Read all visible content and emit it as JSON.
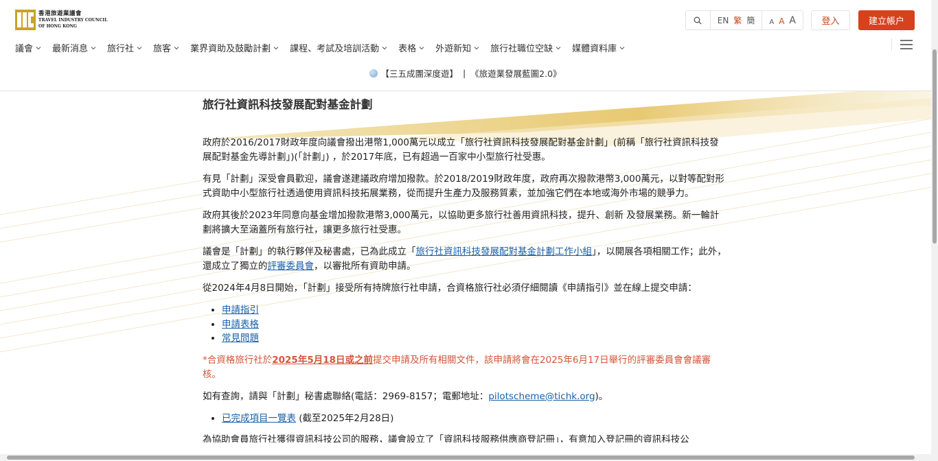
{
  "brand": {
    "logo_zh": "香港旅遊業議會",
    "logo_en_line1": "TRAVEL INDUSTRY COUNCIL",
    "logo_en_line2": "OF HONG KONG",
    "accent_color": "#d7411c"
  },
  "toolbar": {
    "lang_en": "EN",
    "lang_tc": "繁",
    "lang_sc": "簡",
    "size_small": "A",
    "size_medium": "A",
    "size_large": "A",
    "login_label": "登入",
    "register_label": "建立帳户"
  },
  "nav": {
    "items": [
      "議會",
      "最新消息",
      "旅行社",
      "旅客",
      "業界資助及鼓勵計劃",
      "課程、考試及培訓活動",
      "表格",
      "外遊新知",
      "旅行社職位空缺",
      "媒體資料庫"
    ]
  },
  "announcement": {
    "link1": "【三五成團深度遊】",
    "separator": "|",
    "link2": "《旅遊業發展藍圖2.0》"
  },
  "page": {
    "title": "旅行社資訊科技發展配對基金計劃",
    "p1": "政府於2016/2017財政年度向議會撥出港幣1,000萬元以成立「旅行社資訊科技發展配對基金計劃」(前稱「旅行社資訊科技發展配對基金先導計劃」)(「計劃」) ，於2017年底，已有超過一百家中小型旅行社受惠。",
    "p2": "有見「計劃」深受會員歡迎，議會遂建議政府增加撥款。於2018/2019財政年度，政府再次撥款港幣3,000萬元，以對等配對形式資助中小型旅行社透過使用資訊科技拓展業務，從而提升生產力及服務質素，並加強它們在本地或海外市場的競爭力。",
    "p3": "政府其後於2023年同意向基金增加撥款港幣3,000萬元，以協助更多旅行社善用資訊科技，提升、創新 及發展業務。新一輪計劃將擴大至涵蓋所有旅行社，讓更多旅行社受惠。",
    "p4_pre": "議會是「計劃」的執行夥伴及秘書處，已為此成立「",
    "p4_link1": "旅行社資訊科技發展配對基金計劃工作小組",
    "p4_mid": "」，以開展各項相關工作；此外，還成立了獨立的",
    "p4_link2": "評審委員會",
    "p4_post": "，以審批所有資助申請。",
    "p5": "從2024年4月8日開始，「計劃」接受所有持牌旅行社申請，合資格旅行社必須仔細閱讀《申請指引》並在線上提交申請：",
    "links": [
      "申請指引",
      "申請表格",
      "常見問題"
    ],
    "notice_pre": "*合資格旅行社於",
    "notice_bold": "2025年5月18日或之前",
    "notice_post": "提交申請及所有相關文件，該申請將會在2025年6月17日舉行的評審委員會會議審核。",
    "contact_pre": "如有查詢，請與「計劃」秘書處聯絡(電話：2969-8157；電郵地址：",
    "contact_email": "pilotscheme@tichk.org",
    "contact_post": ")。",
    "completed_link": "已完成項目一覽表",
    "completed_note": " (截至2025年2月28日)",
    "cutoff_line": "為協助會員旅行社獲得資訊科技公司的服務，議會設立了「資訊科技服務供應商登記冊」，有意加入登記冊的資訊科技公"
  }
}
